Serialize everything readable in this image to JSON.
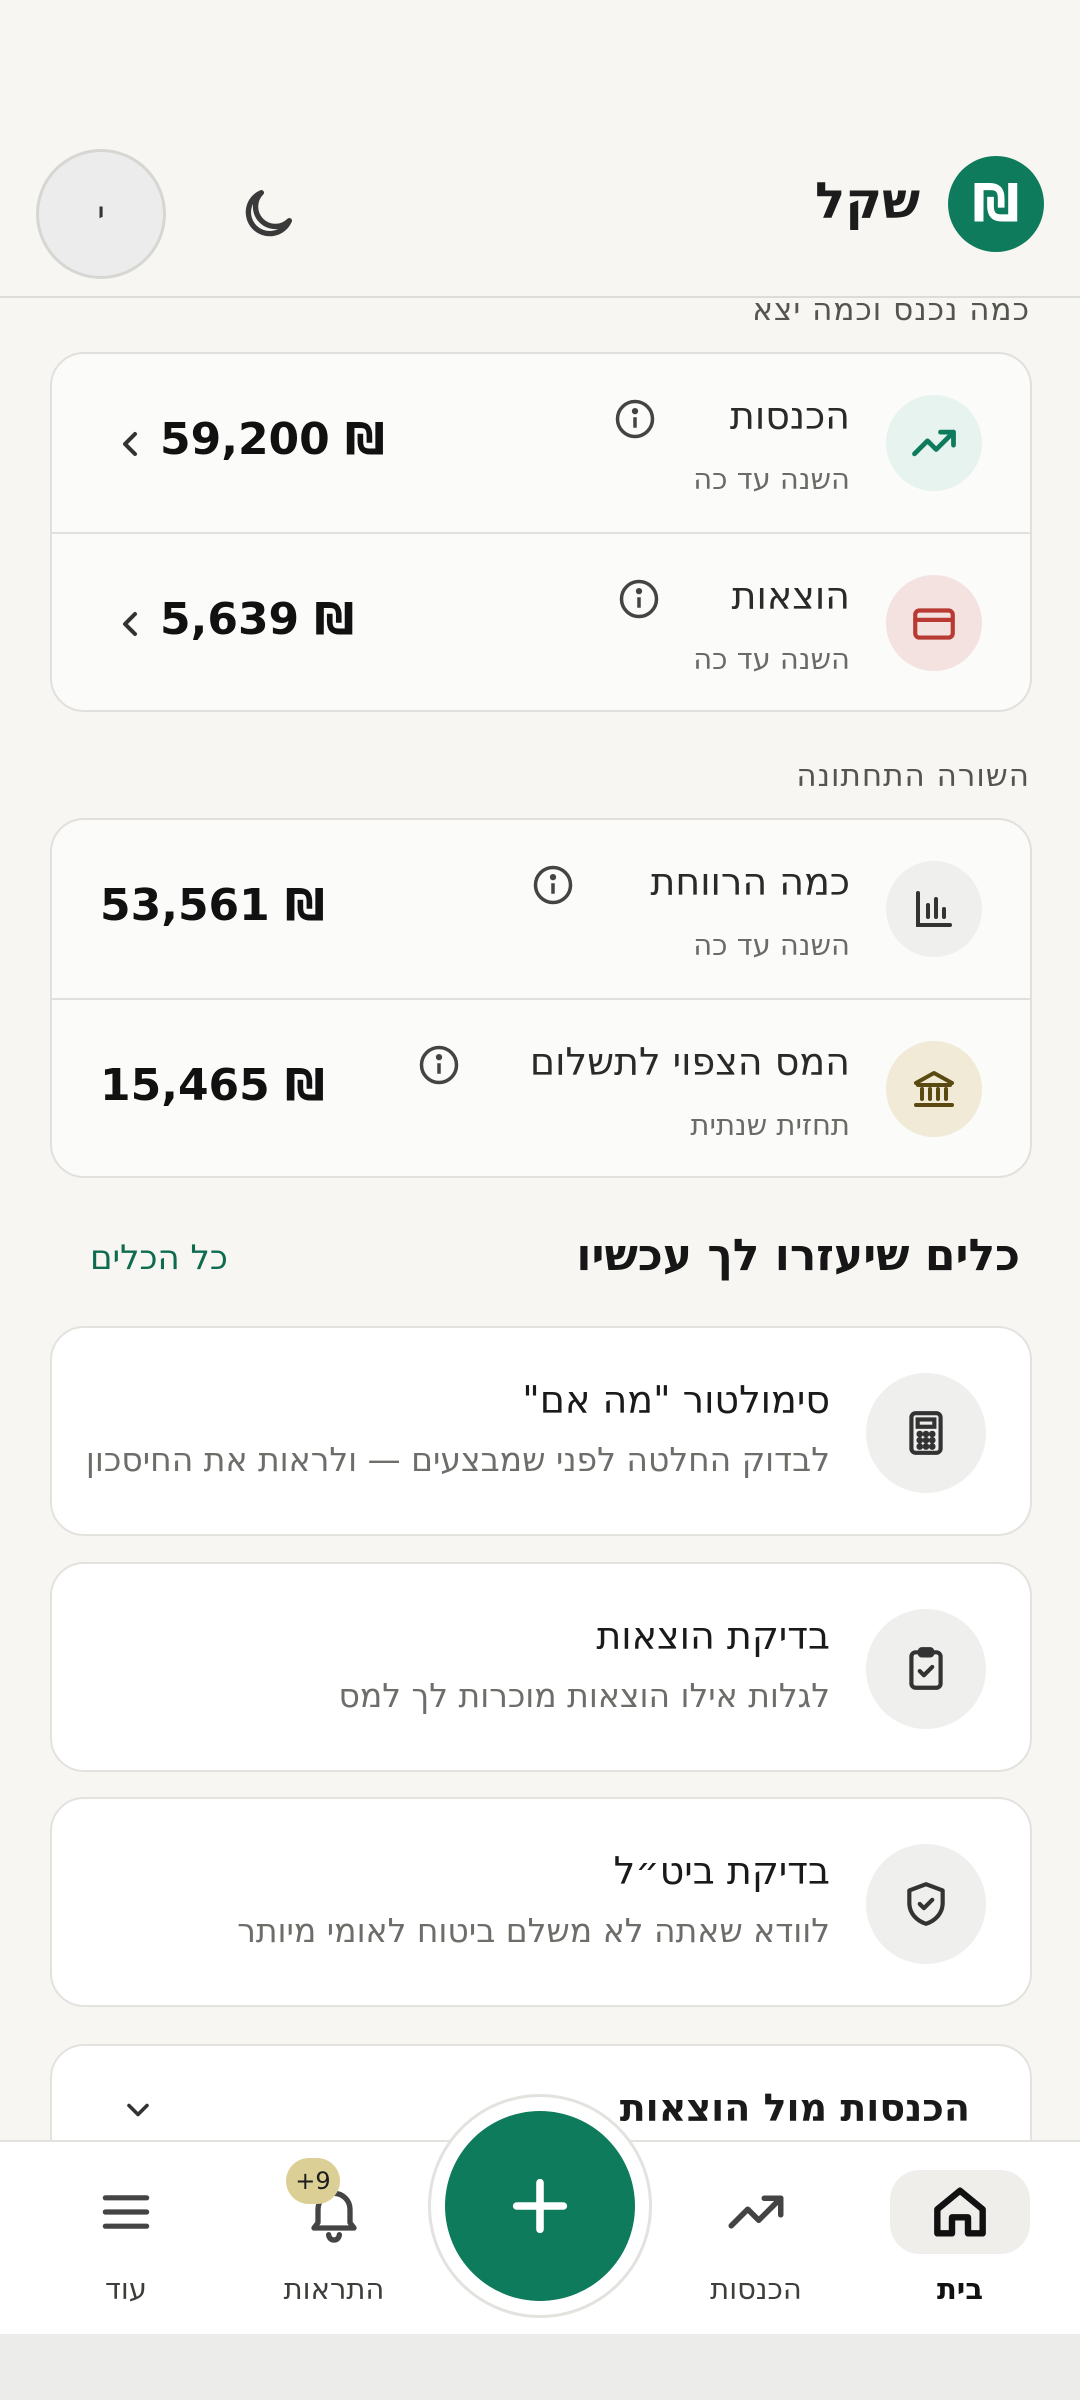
{
  "header": {
    "logo_glyph": "₪",
    "app_name": "שקל",
    "avatar_initial": "י"
  },
  "flow_section": {
    "label": "כמה נכנס וכמה יצא",
    "rows": [
      {
        "title": "הכנסות",
        "subtitle": "השנה עד כה",
        "value": "59,200 ₪",
        "icon": "trending-up-icon",
        "icon_bg": "#e6f3ef",
        "icon_color": "#0e7b5c"
      },
      {
        "title": "הוצאות",
        "subtitle": "השנה עד כה",
        "value": "5,639 ₪",
        "icon": "credit-card-icon",
        "icon_bg": "#f4e2e0",
        "icon_color": "#b83a32"
      }
    ]
  },
  "bottomline_section": {
    "label": "השורה התחתונה",
    "rows": [
      {
        "title": "כמה הרווחת",
        "subtitle": "השנה עד כה",
        "value": "53,561 ₪",
        "icon": "bar-chart-icon",
        "icon_bg": "#efefed",
        "icon_color": "#333333"
      },
      {
        "title": "המס הצפוי לתשלום",
        "subtitle": "תחזית שנתית",
        "value": "15,465 ₪",
        "icon": "bank-icon",
        "icon_bg": "#f0ead6",
        "icon_color": "#5a4a12"
      }
    ]
  },
  "tools": {
    "title": "כלים שיעזרו לך עכשיו",
    "all_link": "כל הכלים",
    "items": [
      {
        "title": "סימולטור \"מה אם\"",
        "desc": "לבדוק החלטה לפני שמבצעים — ולראות את החיסכון",
        "icon": "calculator-icon"
      },
      {
        "title": "בדיקת הוצאות",
        "desc": "לגלות אילו הוצאות מוכרות לך למס",
        "icon": "clipboard-check-icon"
      },
      {
        "title": "בדיקת ביט״ל",
        "desc": "לוודא שאתה לא משלם ביטוח לאומי מיותר",
        "icon": "shield-check-icon"
      }
    ]
  },
  "income_vs_expenses": {
    "title": "הכנסות מול הוצאות"
  },
  "bottom_nav": {
    "home": "בית",
    "income": "הכנסות",
    "alerts": "התראות",
    "alerts_badge": "+9",
    "more": "עוד"
  },
  "colors": {
    "brand": "#0e7b5c",
    "background": "#f7f6f3"
  }
}
